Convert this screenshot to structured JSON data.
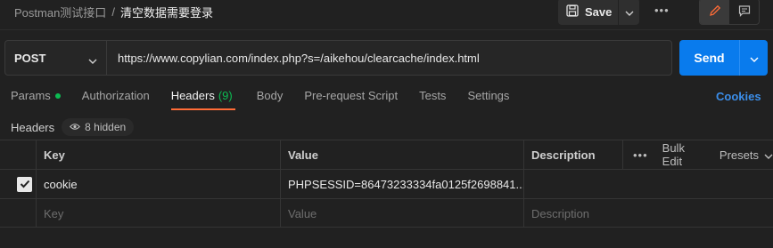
{
  "breadcrumb": {
    "collection": "Postman测试接口",
    "separator": "/",
    "request": "清空数据需要登录"
  },
  "toolbar": {
    "save_label": "Save",
    "more_label": "•••"
  },
  "request": {
    "method": "POST",
    "url": "https://www.copylian.com/index.php?s=/aikehou/clearcache/index.html",
    "send_label": "Send"
  },
  "tabs": [
    {
      "label": "Params"
    },
    {
      "label": "Authorization"
    },
    {
      "label": "Headers",
      "count": "(9)"
    },
    {
      "label": "Body"
    },
    {
      "label": "Pre-request Script"
    },
    {
      "label": "Tests"
    },
    {
      "label": "Settings"
    }
  ],
  "cookies_label": "Cookies",
  "headers_section": {
    "title": "Headers",
    "hidden_label": "8 hidden"
  },
  "table": {
    "columns": {
      "key": "Key",
      "value": "Value",
      "description": "Description"
    },
    "actions": {
      "more": "•••",
      "bulk_edit": "Bulk Edit",
      "presets": "Presets"
    },
    "rows": [
      {
        "checked": true,
        "key": "cookie",
        "value": "PHPSESSID=86473233334fa0125f2698841...",
        "description": ""
      }
    ],
    "placeholder": {
      "key": "Key",
      "value": "Value",
      "description": "Description"
    }
  },
  "colors": {
    "accent": "#ff6c37",
    "send": "#097bed",
    "link": "#3b8eea",
    "green": "#0cbb52"
  }
}
